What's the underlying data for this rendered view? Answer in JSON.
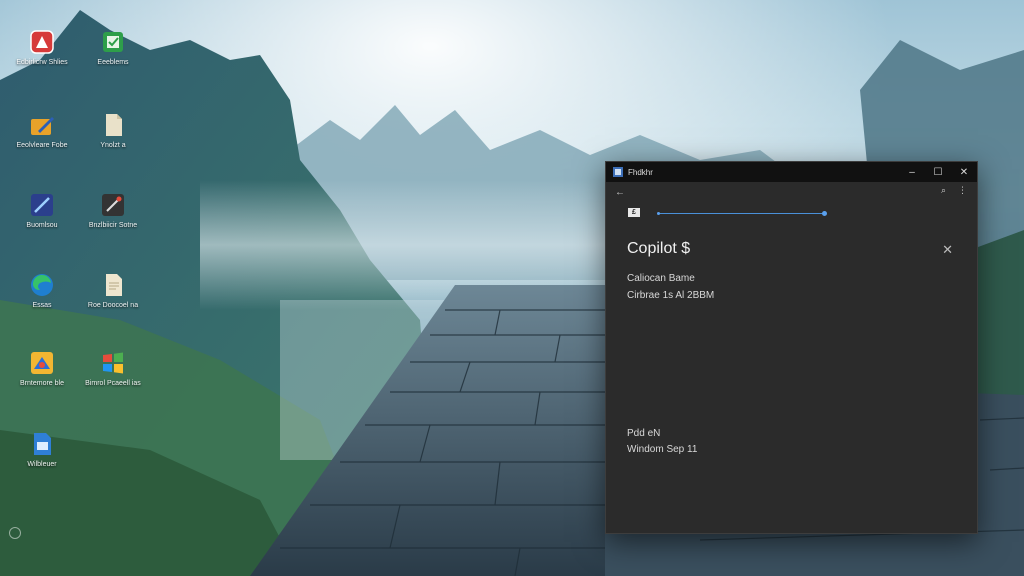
{
  "desktop": {
    "icons": [
      {
        "name": "red-app-icon",
        "label": "Edbirlicrw Shlies",
        "color": "#d63a3a"
      },
      {
        "name": "green-app-icon",
        "label": "Eeeblems",
        "color": "#2e9e4a"
      },
      {
        "name": "folder-pen-icon",
        "label": "Eeolvleare Fobe",
        "color": "#e8a22a"
      },
      {
        "name": "document-icon",
        "label": "Ynolzt a",
        "color": "#e9e1c9"
      },
      {
        "name": "sword-app-icon",
        "label": "Buomlsou",
        "color": "#2b3f8c"
      },
      {
        "name": "dark-tool-icon",
        "label": "Bnzlbiicir Sotne",
        "color": "#333"
      },
      {
        "name": "edge-browser-icon",
        "label": "Essas",
        "color": "#2aa35a"
      },
      {
        "name": "text-document-icon",
        "label": "Roe Doocoel na",
        "color": "#efe6cf"
      },
      {
        "name": "colorful-app-icon",
        "label": "Brntemore ble",
        "color": "#f2b632"
      },
      {
        "name": "windows-logo-icon",
        "label": "Bimrol Pcaeell ias",
        "color": "#e74c3c"
      },
      {
        "name": "blue-document-icon",
        "label": "Wilbleuer",
        "color": "#2f7fd6"
      }
    ]
  },
  "window": {
    "title": "Fhdkhr",
    "controls": {
      "minimize": "–",
      "maximize": "☐",
      "close": "✕"
    },
    "toolbar": {
      "back": "←",
      "search": "⌕",
      "more": "⋮"
    },
    "tag": "£",
    "progress": 1.0,
    "panel_title": "Copilot $",
    "panel_close": "✕",
    "info_line_1": "Caliocan Bame",
    "info_line_2": "Cirbrae 1s Al 2BBM",
    "footer_line_1": "Pdd eN",
    "footer_line_2": "Windom Sep 11"
  }
}
